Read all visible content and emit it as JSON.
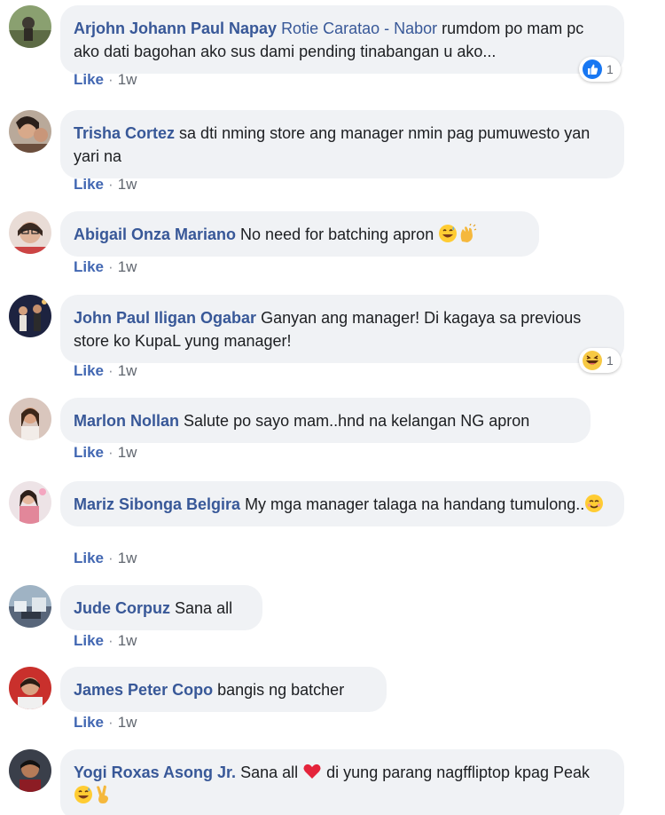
{
  "like_label": "Like",
  "comments": [
    {
      "author": "Arjohn Johann Paul Napay",
      "mention": "Rotie Caratao - Nabor",
      "text": "rumdom po mam pc ako dati bagohan ako sus dami pending tinabangan u ako...",
      "time": "1w",
      "reaction": {
        "type": "like-reaction-icon",
        "count": "1"
      }
    },
    {
      "author": "Trisha Cortez",
      "text": "sa dti nming store ang manager nmin pag pumuwesto yan yari na",
      "time": "1w"
    },
    {
      "author": "Abigail Onza Mariano",
      "text": "No need for batching apron",
      "emojis": [
        "grinning-sweat-emoji",
        "clapping-hands-emoji"
      ],
      "time": "1w"
    },
    {
      "author": "John Paul Iligan Ogabar",
      "text": "Ganyan ang manager! Di kagaya sa previous store ko KupaL yung manager!",
      "time": "1w",
      "reaction": {
        "type": "haha-reaction-icon",
        "count": "1"
      }
    },
    {
      "author": "Marlon Nollan",
      "text": "Salute po sayo mam..hnd na kelangan NG apron",
      "time": "1w"
    },
    {
      "author": "Mariz Sibonga Belgira",
      "text": "My mga manager talaga na handang tumulong..",
      "emojis": [
        "smiling-face-emoji"
      ],
      "time": "1w"
    },
    {
      "author": "Jude Corpuz",
      "text": "Sana all",
      "time": "1w"
    },
    {
      "author": "James Peter Copo",
      "text": "bangis ng batcher",
      "time": "1w"
    },
    {
      "author": "Yogi Roxas Asong Jr.",
      "text": "Sana all",
      "text2": "di yung parang nagffliptop kpag Peak",
      "emojis": [
        "red-heart-emoji"
      ],
      "emojis2": [
        "grinning-sweat-emoji",
        "victory-hand-emoji"
      ]
    }
  ],
  "colors": {
    "author": "#385898",
    "bubble": "#f0f2f5",
    "like_link": "#4267b2",
    "meta": "#616770"
  }
}
